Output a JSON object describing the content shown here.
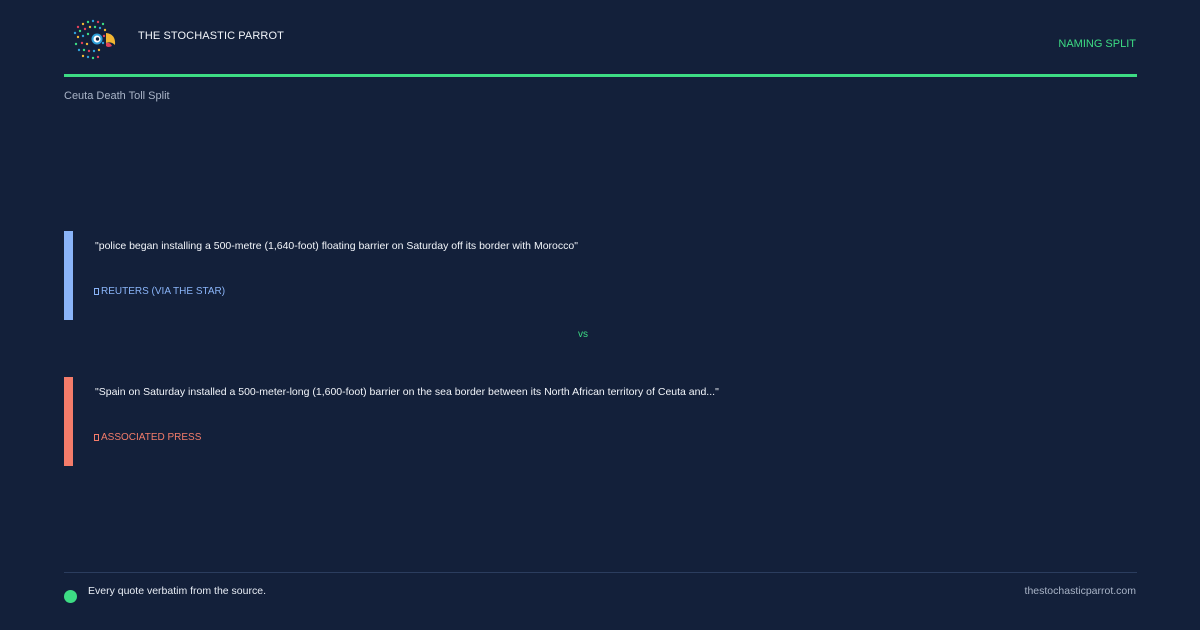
{
  "header": {
    "brand": "THE STOCHASTIC PARROT",
    "tag": "NAMING SPLIT",
    "logo_icon": "parrot-logo-icon"
  },
  "subtitle": "Ceuta Death Toll Split",
  "quotes": [
    {
      "text": "\"police began installing a 500-metre (1,640-foot) floating barrier on Saturday off its border with Morocco\"",
      "source": "REUTERS (VIA THE STAR)",
      "accent": "#8ab4f8"
    },
    {
      "text": "\"Spain on Saturday installed a 500-meter-long (1,600-foot) barrier on the sea border between its North African territory of Ceuta and...\"",
      "source": "ASSOCIATED PRESS",
      "accent": "#f47c6a"
    }
  ],
  "vs_label": "vs",
  "footer": {
    "note": "Every quote verbatim from the source.",
    "site": "thestochasticparrot.com"
  },
  "colors": {
    "background": "#13203a",
    "accent_green": "#3ddc84",
    "reuters": "#8ab4f8",
    "ap": "#f47c6a"
  }
}
